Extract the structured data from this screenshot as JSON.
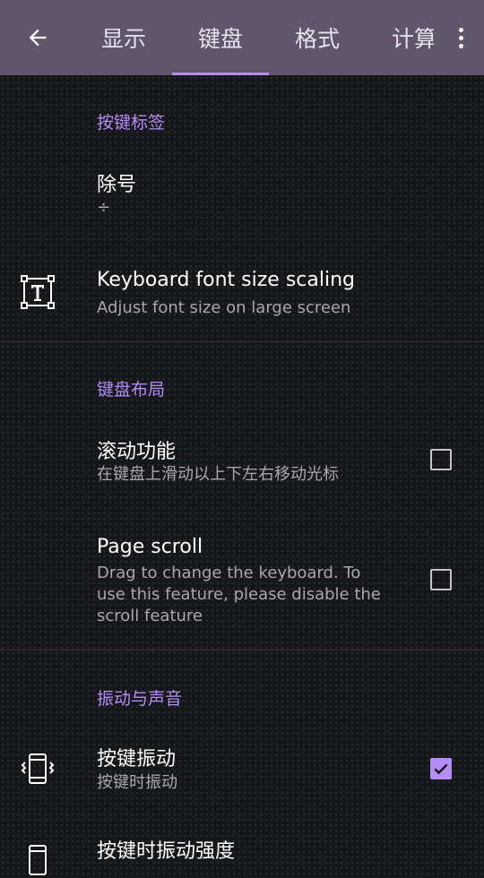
{
  "appbar": {
    "tabs": [
      {
        "label": "显示"
      },
      {
        "label": "键盘"
      },
      {
        "label": "格式"
      },
      {
        "label": "计算"
      }
    ],
    "active_tab": "键盘",
    "colors": {
      "background": "#60566b",
      "indicator": "#b48cf8"
    }
  },
  "sections": {
    "key_labels": {
      "title": "按键标签",
      "division": {
        "title": "除号",
        "summary": "÷"
      },
      "font_scaling": {
        "title": "Keyboard font size scaling",
        "summary": "Adjust font size on large screen",
        "icon": "text-format-icon"
      }
    },
    "keyboard_layout": {
      "title": "键盘布局",
      "scroll_function": {
        "title": "滚动功能",
        "summary": "在键盘上滑动以上下左右移动光标",
        "checked": false
      },
      "page_scroll": {
        "title": "Page scroll",
        "summary": "Drag to change the keyboard. To use this feature, please disable the scroll feature",
        "checked": false
      }
    },
    "vibration_sound": {
      "title": "振动与声音",
      "key_vibration": {
        "title": "按键振动",
        "summary": "按键时振动",
        "checked": true,
        "icon": "vibration-icon"
      },
      "vibration_strength": {
        "title": "按键时振动强度",
        "icon": "phone-icon"
      }
    }
  },
  "colors": {
    "accent": "#b48cf8",
    "background": "#161719",
    "summary_text": "#a9a8ad"
  }
}
